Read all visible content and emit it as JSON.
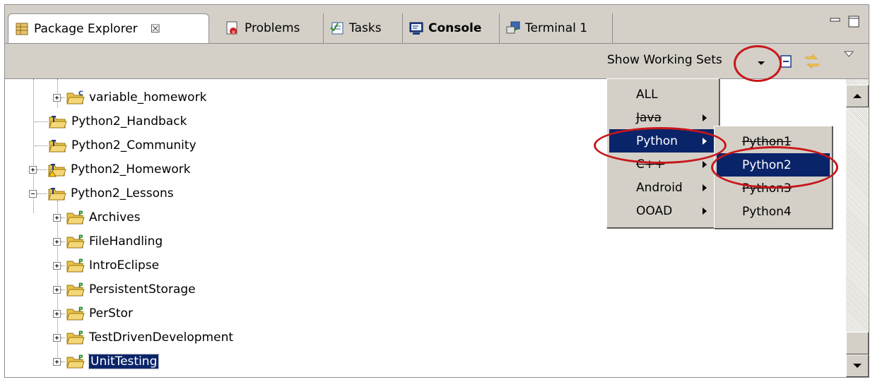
{
  "tabs": [
    {
      "label": "Package Explorer",
      "icon": "package-explorer-icon",
      "active": true,
      "close": "☒"
    },
    {
      "label": "Problems",
      "icon": "problems-icon"
    },
    {
      "label": "Tasks",
      "icon": "tasks-icon"
    },
    {
      "label": "Console",
      "icon": "console-icon",
      "bold": true
    },
    {
      "label": "Terminal 1",
      "icon": "terminal-icon"
    }
  ],
  "toolbar": {
    "show_working_sets": "Show Working Sets"
  },
  "tree": {
    "items": [
      {
        "label": "variable_homework",
        "level": 1,
        "expander": "plus",
        "icon": "c-project-folder-icon"
      },
      {
        "label": "Python2_Handback",
        "level": 0,
        "expander": "none",
        "icon": "python-project-folder-icon"
      },
      {
        "label": "Python2_Community",
        "level": 0,
        "expander": "none",
        "icon": "python-project-folder-icon"
      },
      {
        "label": "Python2_Homework",
        "level": 0,
        "expander": "plus",
        "icon": "python-project-folder-warning-icon"
      },
      {
        "label": "Python2_Lessons",
        "level": 0,
        "expander": "minus",
        "icon": "python-project-folder-icon"
      },
      {
        "label": "Archives",
        "level": 1,
        "expander": "plus",
        "icon": "p-project-folder-icon"
      },
      {
        "label": "FileHandling",
        "level": 1,
        "expander": "plus",
        "icon": "p-project-folder-icon"
      },
      {
        "label": "IntroEclipse",
        "level": 1,
        "expander": "plus",
        "icon": "p-project-folder-icon"
      },
      {
        "label": "PersistentStorage",
        "level": 1,
        "expander": "plus",
        "icon": "p-project-folder-icon"
      },
      {
        "label": "PerStor",
        "level": 1,
        "expander": "plus",
        "icon": "p-project-folder-icon"
      },
      {
        "label": "TestDrivenDevelopment",
        "level": 1,
        "expander": "plus",
        "icon": "p-project-folder-icon"
      },
      {
        "label": "UnitTesting",
        "level": 1,
        "expander": "plus",
        "icon": "p-project-folder-icon",
        "selected": true
      }
    ]
  },
  "menu": {
    "items": [
      "ALL",
      "Java",
      "Python",
      "C++",
      "Android",
      "OOAD"
    ],
    "highlighted": "Python"
  },
  "submenu": {
    "items": [
      "Python1",
      "Python2",
      "Python3",
      "Python4"
    ],
    "highlighted": "Python2"
  },
  "colors": {
    "highlight": "#0a246a",
    "annotation": "#c8171b",
    "chrome": "#d4d0c8"
  }
}
